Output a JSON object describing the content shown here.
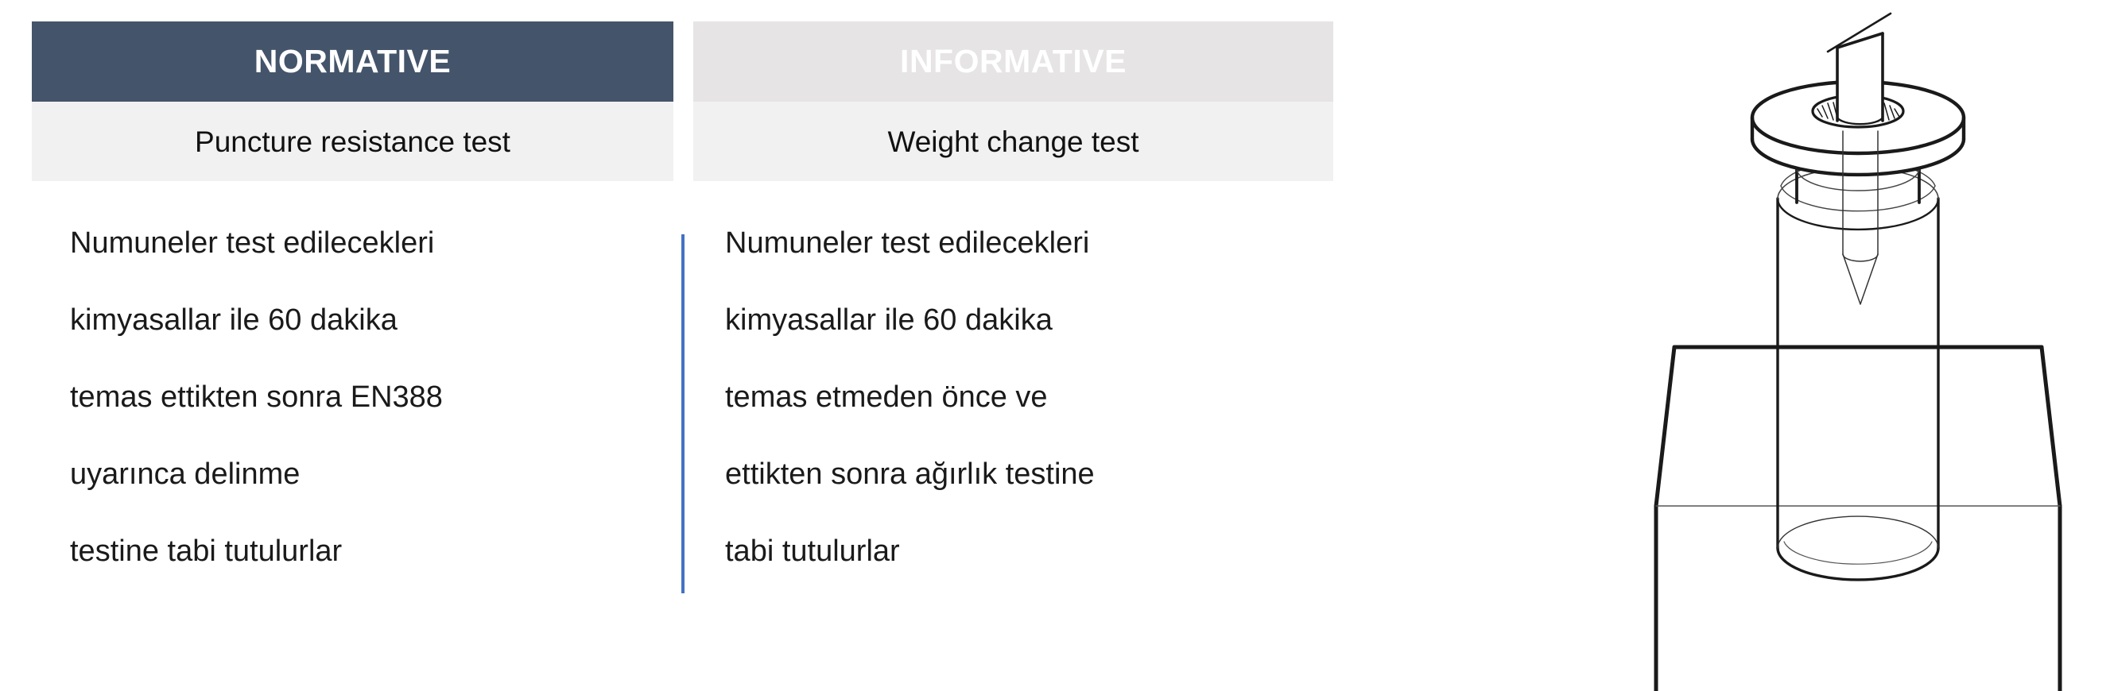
{
  "table": {
    "columns": [
      {
        "id": "normative",
        "header": "NORMATIVE",
        "subheader": "Puncture resistance test",
        "header_bg": "#44546A",
        "header_color": "#FFFFFF",
        "subheader_bg": "#F1F1F1",
        "lines": [
          "Numuneler test edilecekleri",
          "kimyasallar ile 60 dakika",
          "temas ettikten sonra EN388",
          "uyarınca delinme",
          "testine tabi tutulurlar"
        ]
      },
      {
        "id": "informative",
        "header": "INFORMATIVE",
        "subheader": "Weight change test",
        "header_bg": "#E6E4E4",
        "header_color": "#FFFFFF",
        "subheader_bg": "#F1F1F1",
        "lines": [
          "Numuneler test edilecekleri",
          "kimyasallar ile 60 dakika",
          "temas etmeden önce ve",
          "ettikten sonra ağırlık testine",
          "tabi tutulurlar"
        ]
      }
    ],
    "divider_color": "#4472C4"
  },
  "illustration": {
    "name": "puncture-test-apparatus-diagram",
    "description": "Line drawing of a beveled puncture probe passing through a flanged collar into a glass vial mounted on a block stand",
    "line_color": "#1a1a1a",
    "fill_color": "#FFFFFF",
    "parts": [
      "beveled-probe-tip",
      "probe-shaft",
      "flanged-collar-disc",
      "collar-neck",
      "glass-vial-cylinder",
      "conical-probe-point",
      "block-stand"
    ]
  }
}
